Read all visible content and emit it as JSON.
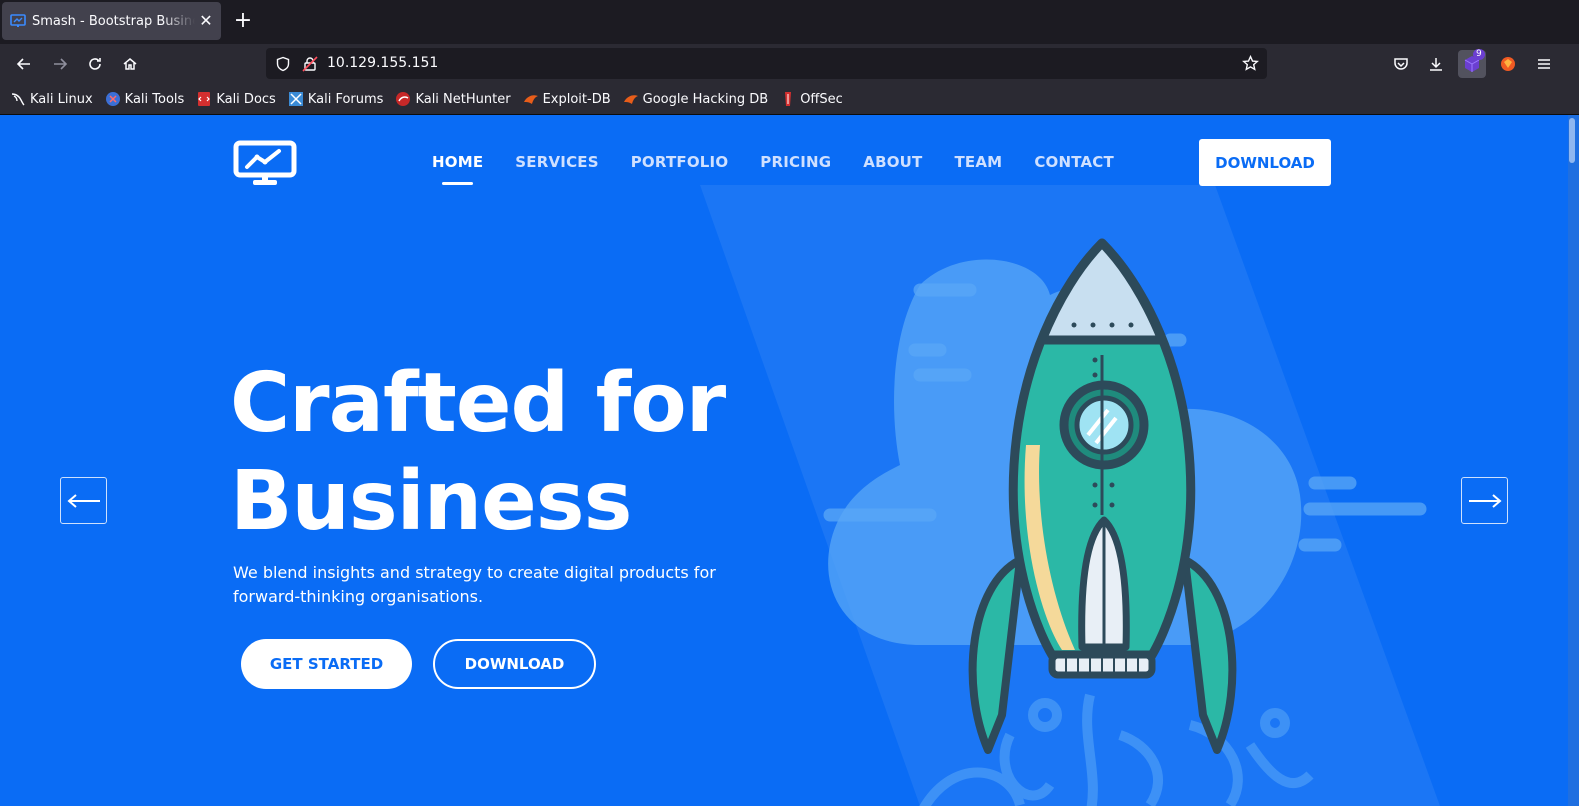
{
  "browser": {
    "tab_title": "Smash - Bootstrap Business",
    "close_glyph": "✕",
    "new_tab_glyph": "+",
    "url": "10.129.155.151",
    "extension_badge": "9",
    "bookmarks": [
      {
        "label": "Kali Linux",
        "icon": "kali-dragon-icon"
      },
      {
        "label": "Kali Tools",
        "icon": "kali-tools-icon"
      },
      {
        "label": "Kali Docs",
        "icon": "kali-docs-icon"
      },
      {
        "label": "Kali Forums",
        "icon": "kali-forums-icon"
      },
      {
        "label": "Kali NetHunter",
        "icon": "nethunter-icon"
      },
      {
        "label": "Exploit-DB",
        "icon": "exploit-db-icon"
      },
      {
        "label": "Google Hacking DB",
        "icon": "ghdb-icon"
      },
      {
        "label": "OffSec",
        "icon": "offsec-icon"
      }
    ]
  },
  "site": {
    "nav": [
      {
        "label": "HOME",
        "active": true
      },
      {
        "label": "SERVICES"
      },
      {
        "label": "PORTFOLIO"
      },
      {
        "label": "PRICING"
      },
      {
        "label": "ABOUT"
      },
      {
        "label": "TEAM"
      },
      {
        "label": "CONTACT"
      }
    ],
    "header_download": "DOWNLOAD",
    "hero": {
      "title_line1": "Crafted for",
      "title_line2": "Business",
      "subtitle": "We blend insights and strategy to create digital products for forward-thinking organisations.",
      "cta_primary": "GET STARTED",
      "cta_secondary": "DOWNLOAD"
    },
    "colors": {
      "primary": "#0a6cf5",
      "rocket_body": "#2bb8a6",
      "rocket_outline": "#2d4a5a"
    }
  }
}
